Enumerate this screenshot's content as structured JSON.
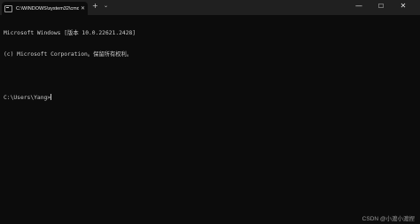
{
  "tab": {
    "title": "C:\\WINDOWS\\system32\\cmd.",
    "icon": "terminal-icon",
    "close_glyph": "✕"
  },
  "tabstrip": {
    "new_tab_glyph": "+",
    "dropdown_glyph": "⌄"
  },
  "window_controls": {
    "minimize_glyph": "—",
    "maximize_glyph": "☐",
    "close_glyph": "✕"
  },
  "terminal": {
    "lines": [
      "Microsoft Windows [版本 10.0.22621.2428]",
      "(c) Microsoft Corporation。保留所有权利。",
      "",
      "C:\\Users\\Yang>"
    ]
  },
  "watermark": "CSDN @小渡小渡捏",
  "colors": {
    "background": "#0c0c0c",
    "titlebar": "#202020",
    "text": "#cccccc"
  }
}
